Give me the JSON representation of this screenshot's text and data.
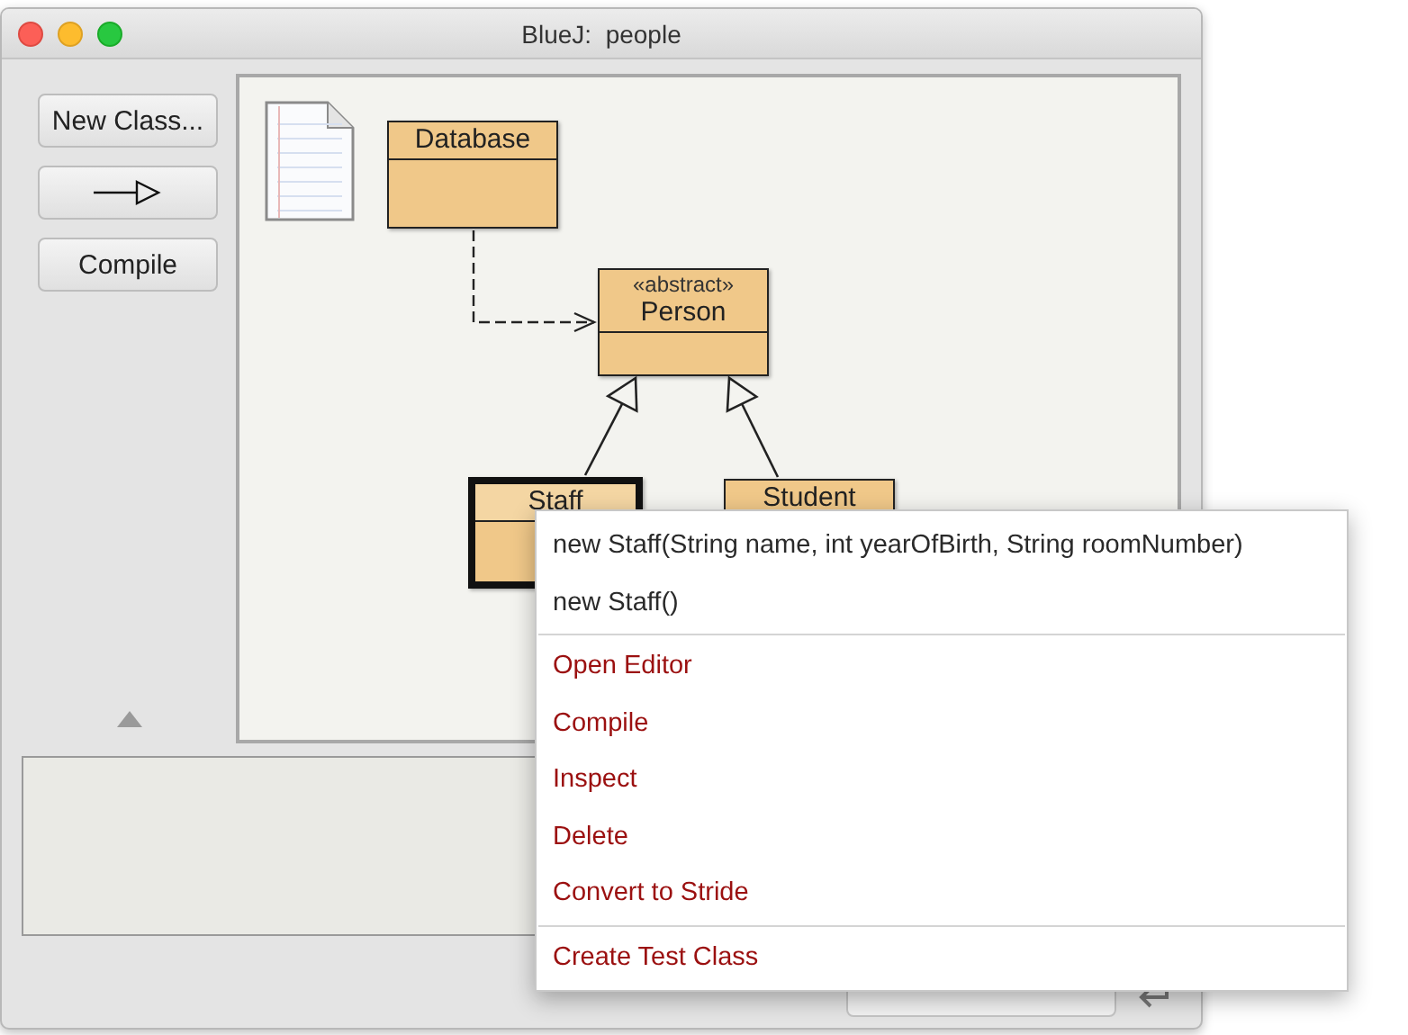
{
  "window": {
    "title": "BlueJ:  people"
  },
  "tool_buttons": [
    {
      "kind": "text",
      "label": "New Class..."
    },
    {
      "kind": "arrow"
    },
    {
      "kind": "text",
      "label": "Compile"
    }
  ],
  "classes": [
    {
      "name": "Database",
      "selected": false
    },
    {
      "name": "Person",
      "stereotype": "«abstract»",
      "selected": false
    },
    {
      "name": "Staff",
      "selected": true
    },
    {
      "name": "Student",
      "selected": false
    }
  ],
  "relations": [
    {
      "kind": "uses"
    },
    {
      "kind": "extends"
    },
    {
      "kind": "extends"
    }
  ],
  "context_menu": [
    [
      {
        "kind": "constructor",
        "label": "new Staff(String name, int yearOfBirth, String roomNumber)"
      },
      {
        "kind": "constructor",
        "label": "new Staff()"
      }
    ],
    [
      {
        "kind": "command",
        "label": "Open Editor"
      },
      {
        "kind": "command",
        "label": "Compile"
      },
      {
        "kind": "command",
        "label": "Inspect"
      },
      {
        "kind": "command",
        "label": "Delete"
      },
      {
        "kind": "command",
        "label": "Convert to Stride"
      }
    ],
    [
      {
        "kind": "command",
        "label": "Create Test Class"
      }
    ]
  ]
}
